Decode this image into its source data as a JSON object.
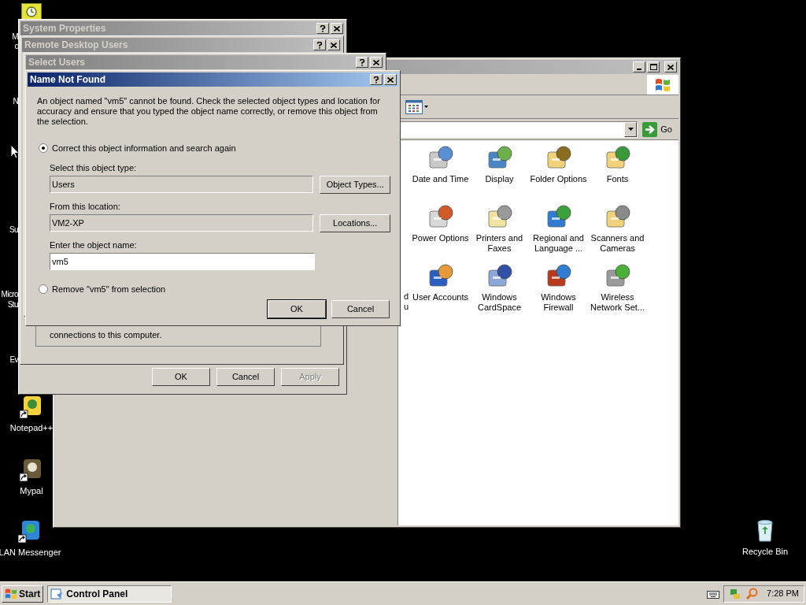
{
  "desktop": {
    "cut_labels": [
      "M",
      "c",
      "N",
      "Su",
      "Micro",
      "Stu",
      "Ev"
    ],
    "icons": [
      {
        "label": "Notepad++",
        "shortcut": true
      },
      {
        "label": "Mypal",
        "shortcut": true
      },
      {
        "label": "LAN Messenger",
        "shortcut": true
      },
      {
        "label": "Recycle Bin",
        "shortcut": false
      }
    ]
  },
  "control_panel": {
    "active": false,
    "go": "Go",
    "cut_column": [
      "d",
      "u"
    ],
    "items": [
      {
        "label": "Date and Time"
      },
      {
        "label": "Display"
      },
      {
        "label": "Folder Options"
      },
      {
        "label": "Fonts"
      },
      {
        "label": "Power Options"
      },
      {
        "label": "Printers and Faxes"
      },
      {
        "label": "Regional and Language ..."
      },
      {
        "label": "Scanners and Cameras"
      },
      {
        "label": "User Accounts"
      },
      {
        "label": "Windows CardSpace"
      },
      {
        "label": "Windows Firewall"
      },
      {
        "label": "Wireless Network Set..."
      }
    ]
  },
  "system_properties": {
    "title": "System Properties",
    "active": false,
    "buttons": [
      {
        "label": "OK",
        "disabled": false
      },
      {
        "label": "Cancel",
        "disabled": false
      },
      {
        "label": "Apply",
        "disabled": true
      }
    ]
  },
  "remote_desktop_users": {
    "title": "Remote Desktop Users",
    "active": false,
    "group_text": "connections to this computer."
  },
  "select_users": {
    "title": "Select Users",
    "active": false
  },
  "name_not_found": {
    "title": "Name Not Found",
    "active": true,
    "message": "An object named \"vm5\" cannot be found. Check the selected object types and location for accuracy and ensure that you typed the object name correctly, or remove this object from the selection.",
    "options": [
      {
        "label": "Correct this object information and search again",
        "selected": true
      },
      {
        "label": "Remove \"vm5\" from selection",
        "selected": false
      }
    ],
    "fields": [
      {
        "label": "Select this object type:",
        "value": "Users",
        "button": "Object Types...",
        "readonly": true
      },
      {
        "label": "From this location:",
        "value": "VM2-XP",
        "button": "Locations...",
        "readonly": true
      },
      {
        "label": "Enter the object name:",
        "value": "vm5",
        "readonly": false
      }
    ],
    "buttons": [
      {
        "label": "OK",
        "default": true
      },
      {
        "label": "Cancel",
        "default": false
      }
    ]
  },
  "taskbar": {
    "start": "Start",
    "tasks": [
      {
        "label": "Control Panel"
      }
    ],
    "clock": "7:28 PM"
  }
}
